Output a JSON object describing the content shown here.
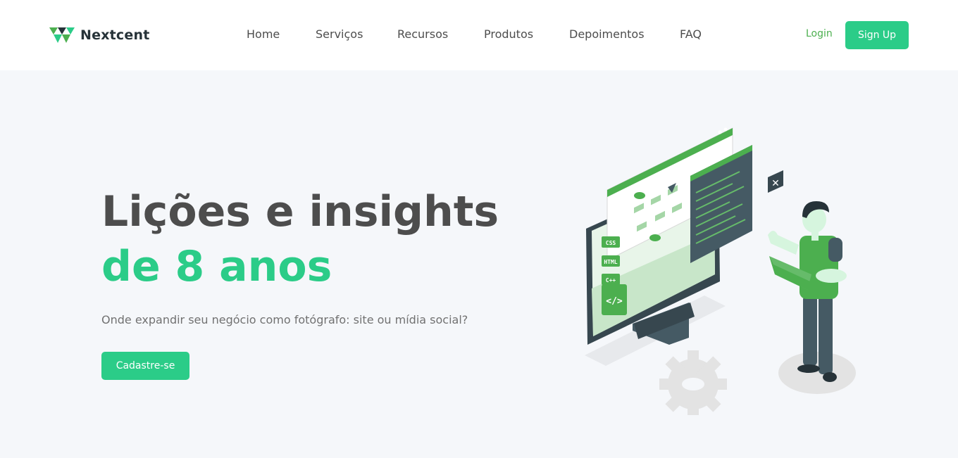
{
  "brand": {
    "name": "Nextcent",
    "logo_icon": "triangles-logo-icon",
    "accent": "#2bcc88",
    "green": "#4caf4f"
  },
  "nav": {
    "items": [
      {
        "label": "Home"
      },
      {
        "label": "Serviços"
      },
      {
        "label": "Recursos"
      },
      {
        "label": "Produtos"
      },
      {
        "label": "Depoimentos"
      },
      {
        "label": "FAQ"
      }
    ]
  },
  "auth": {
    "login_label": "Login",
    "signup_label": "Sign Up"
  },
  "hero": {
    "title_line1": "Lições e insights",
    "title_line2": "de 8 anos",
    "subtitle": "Onde expandir seu negócio como fotógrafo: site ou mídia social?",
    "cta_label": "Cadastre-se"
  },
  "illustration": {
    "tags": [
      "CSS",
      "HTML",
      "C++"
    ],
    "code_symbol": "</>",
    "close_symbol": "✕"
  }
}
